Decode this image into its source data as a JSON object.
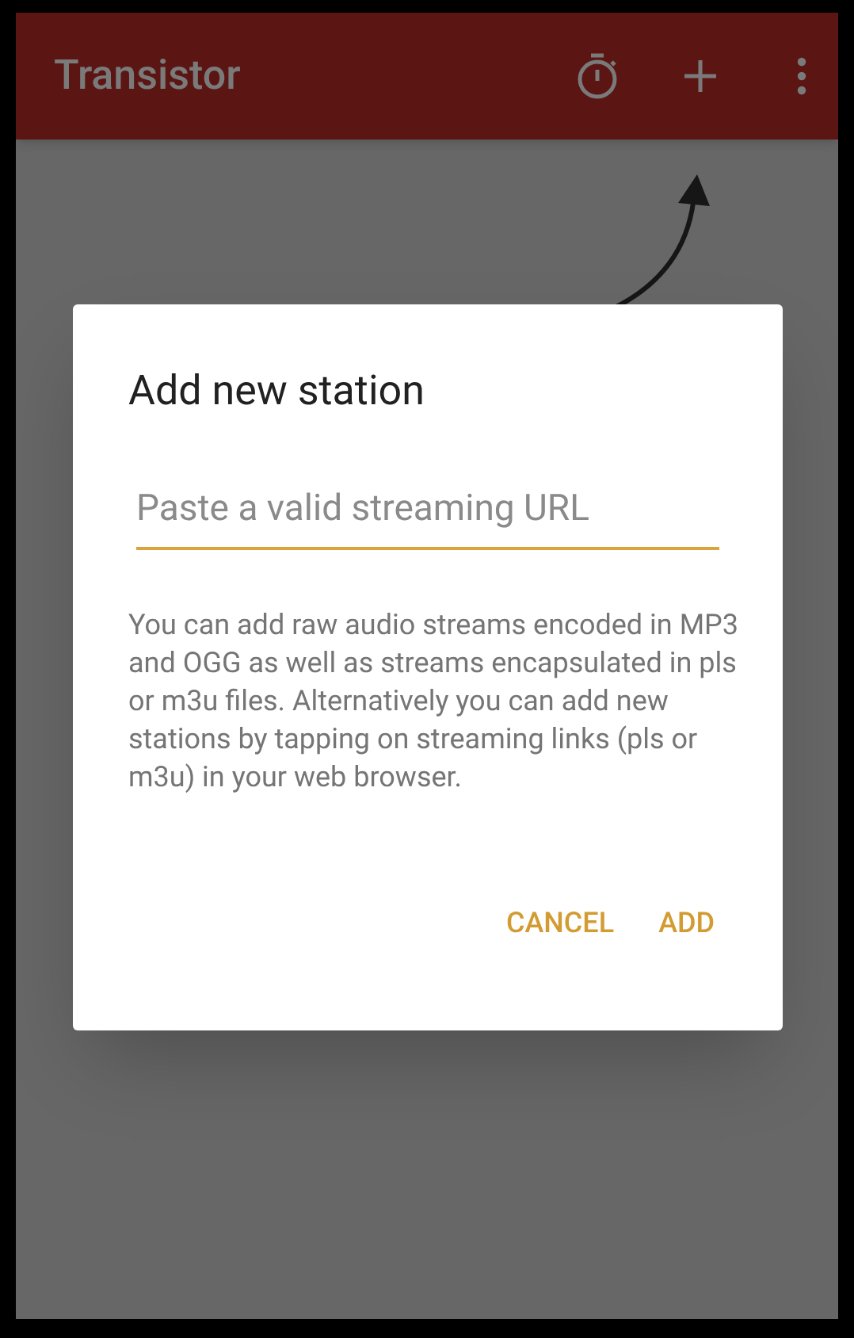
{
  "app_bar": {
    "title": "Transistor"
  },
  "dialog": {
    "title": "Add new station",
    "url_field": {
      "placeholder": "Paste a valid streaming URL"
    },
    "description": "You can add raw audio streams encoded in MP3 and OGG as well as streams encapsulated in pls or m3u files. Alternatively you can add new stations by tapping on streaming links (pls or m3u) in your web browser.",
    "buttons": [
      "CANCEL",
      "ADD"
    ]
  }
}
